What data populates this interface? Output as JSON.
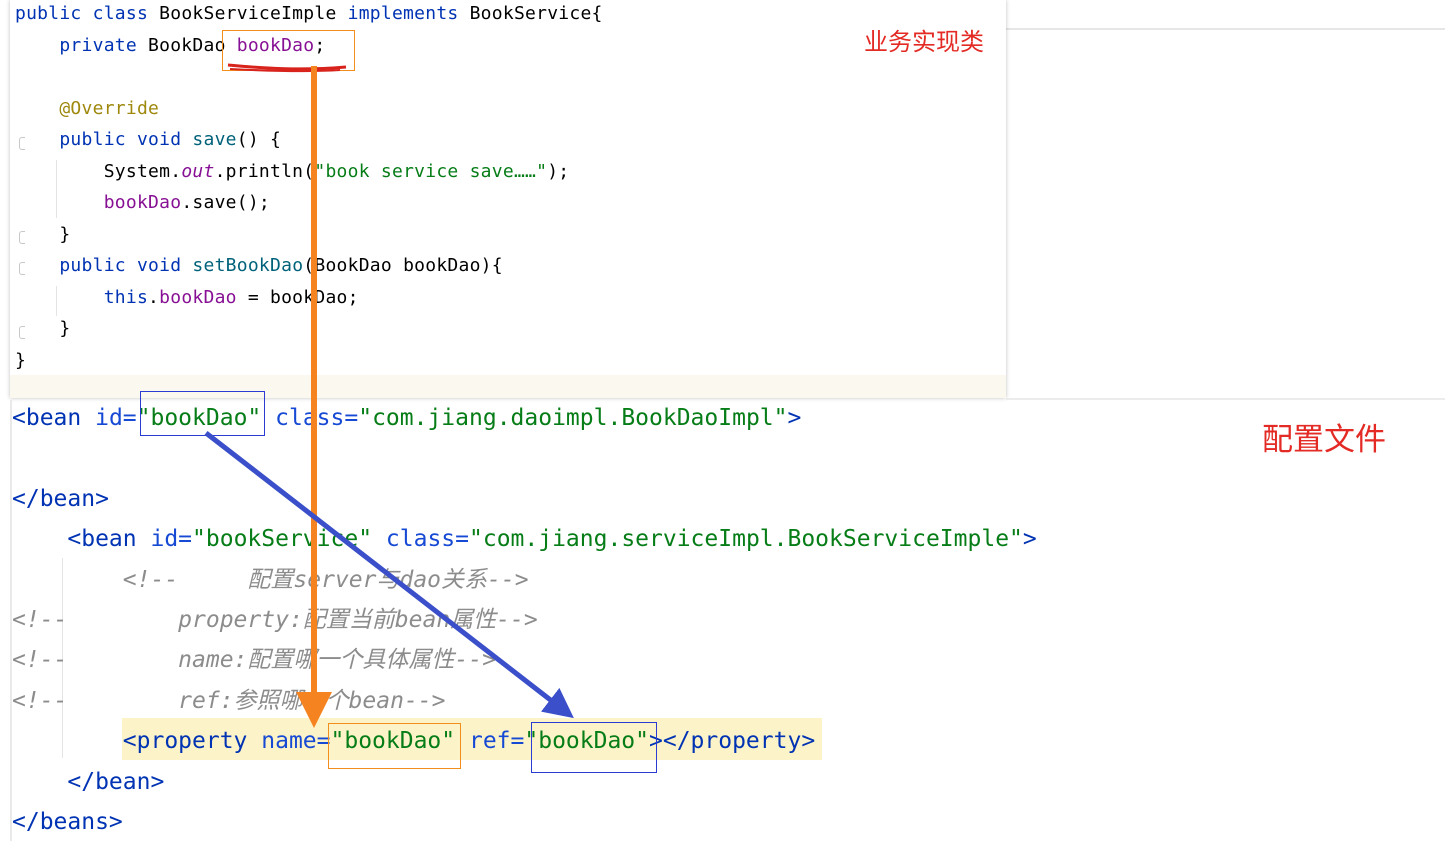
{
  "java": {
    "lines": [
      {
        "parts": [
          {
            "t": "public ",
            "c": "kw"
          },
          {
            "t": "class ",
            "c": "kw"
          },
          {
            "t": "BookServiceImple ",
            "c": ""
          },
          {
            "t": "implements ",
            "c": "kw"
          },
          {
            "t": "BookService{",
            "c": ""
          }
        ]
      },
      {
        "parts": [
          {
            "t": "    private ",
            "c": "kw"
          },
          {
            "t": "BookDao ",
            "c": ""
          },
          {
            "t": "bookDao",
            "c": "fld"
          },
          {
            "t": ";",
            "c": ""
          }
        ]
      },
      {
        "parts": []
      },
      {
        "parts": [
          {
            "t": "    @Override",
            "c": "ann"
          }
        ]
      },
      {
        "parts": [
          {
            "t": "    public ",
            "c": "kw"
          },
          {
            "t": "void ",
            "c": "kw"
          },
          {
            "t": "save",
            "c": "mth"
          },
          {
            "t": "() {",
            "c": ""
          }
        ]
      },
      {
        "parts": [
          {
            "t": "        System.",
            "c": ""
          },
          {
            "t": "out",
            "c": "sfld"
          },
          {
            "t": ".println(",
            "c": ""
          },
          {
            "t": "\"book service save……\"",
            "c": "str"
          },
          {
            "t": ");",
            "c": ""
          }
        ]
      },
      {
        "parts": [
          {
            "t": "        bookDao",
            "c": "fld"
          },
          {
            "t": ".save();",
            "c": ""
          }
        ]
      },
      {
        "parts": [
          {
            "t": "    }",
            "c": ""
          }
        ]
      },
      {
        "parts": [
          {
            "t": "    public ",
            "c": "kw"
          },
          {
            "t": "void ",
            "c": "kw"
          },
          {
            "t": "setBookDao",
            "c": "mth"
          },
          {
            "t": "(BookDao bookDao){",
            "c": ""
          }
        ]
      },
      {
        "parts": [
          {
            "t": "        this",
            "c": "kw"
          },
          {
            "t": ".",
            "c": ""
          },
          {
            "t": "bookDao",
            "c": "fld"
          },
          {
            "t": " = bookDao;",
            "c": ""
          }
        ]
      },
      {
        "parts": [
          {
            "t": "    }",
            "c": ""
          }
        ]
      },
      {
        "parts": [
          {
            "t": "}",
            "c": ""
          }
        ]
      }
    ]
  },
  "xml": {
    "lines": [
      {
        "parts": [
          {
            "t": "<bean ",
            "c": "tag"
          },
          {
            "t": "id=",
            "c": "attr"
          },
          {
            "t": "\"bookDao\"",
            "c": "val"
          },
          {
            "t": " ",
            "c": ""
          },
          {
            "t": "class=",
            "c": "attr"
          },
          {
            "t": "\"com.jiang.daoimpl.BookDaoImpl\"",
            "c": "val"
          },
          {
            "t": ">",
            "c": "tag"
          }
        ]
      },
      {
        "parts": []
      },
      {
        "parts": [
          {
            "t": "</bean>",
            "c": "tag"
          }
        ]
      },
      {
        "parts": [
          {
            "t": "    <bean ",
            "c": "tag"
          },
          {
            "t": "id=",
            "c": "attr"
          },
          {
            "t": "\"bookService\"",
            "c": "val"
          },
          {
            "t": " ",
            "c": ""
          },
          {
            "t": "class=",
            "c": "attr"
          },
          {
            "t": "\"com.jiang.serviceImpl.BookServiceImple\"",
            "c": "val"
          },
          {
            "t": ">",
            "c": "tag"
          }
        ]
      },
      {
        "parts": [
          {
            "t": "        <!--     配置server与dao关系-->",
            "c": "cmt"
          }
        ]
      },
      {
        "parts": [
          {
            "t": "<!--        property:配置当前bean属性-->",
            "c": "cmt"
          }
        ]
      },
      {
        "parts": [
          {
            "t": "<!--        name:配置哪一个具体属性-->",
            "c": "cmt"
          }
        ]
      },
      {
        "parts": [
          {
            "t": "<!--        ref:参照哪一个bean-->",
            "c": "cmt"
          }
        ]
      },
      {
        "parts": [
          {
            "t": "        <property ",
            "c": "tag"
          },
          {
            "t": "name=",
            "c": "attr"
          },
          {
            "t": "\"bookDao\"",
            "c": "val"
          },
          {
            "t": " ",
            "c": ""
          },
          {
            "t": "ref=",
            "c": "attr"
          },
          {
            "t": "\"bookDao\"",
            "c": "val"
          },
          {
            "t": "></property>",
            "c": "tag"
          }
        ]
      },
      {
        "parts": [
          {
            "t": "    </bean>",
            "c": "tag"
          }
        ]
      },
      {
        "parts": [
          {
            "t": "</beans>",
            "c": "tag"
          }
        ]
      }
    ]
  },
  "labels": {
    "business_impl": "业务实现类",
    "config_file": "配置文件"
  },
  "colors": {
    "orange_arrow": "#f5831f",
    "blue_arrow": "#3a4fc9",
    "red_label": "#e32a24",
    "red_underline": "#d8221c"
  }
}
